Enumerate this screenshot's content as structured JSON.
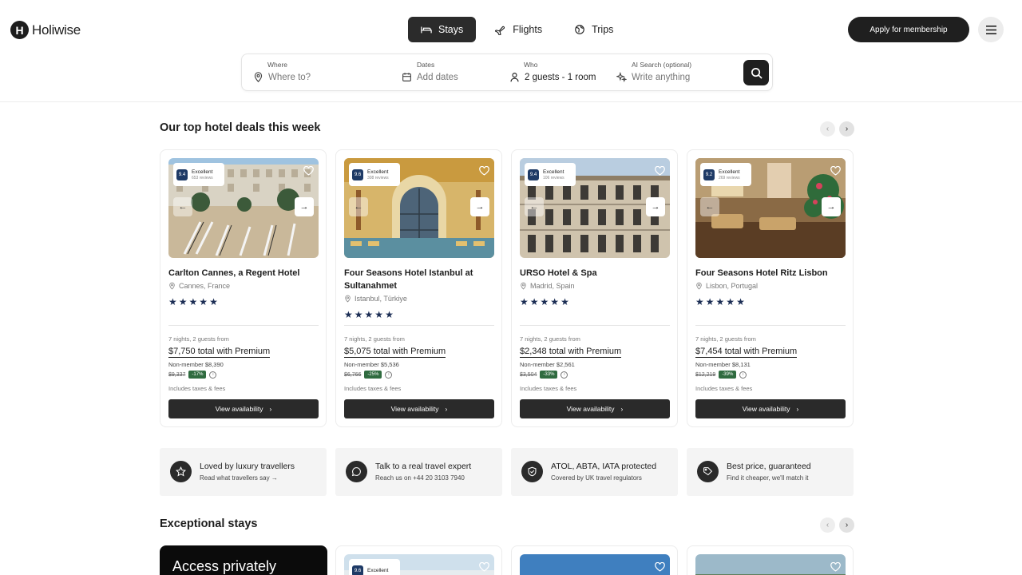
{
  "brand": {
    "name": "Holiwise",
    "mark": "H"
  },
  "nav": {
    "tabs": [
      {
        "label": "Stays",
        "icon": "bed-icon"
      },
      {
        "label": "Flights",
        "icon": "plane-icon"
      },
      {
        "label": "Trips",
        "icon": "globe-icon"
      }
    ],
    "apply_label": "Apply for membership"
  },
  "search": {
    "where_label": "Where",
    "where_placeholder": "Where to?",
    "dates_label": "Dates",
    "dates_placeholder": "Add dates",
    "who_label": "Who",
    "who_value": "2 guests - 1 room",
    "ai_label": "AI Search (optional)",
    "ai_placeholder": "Write anything"
  },
  "deals": {
    "title": "Our top hotel deals this week",
    "hotels": [
      {
        "name": "Carlton Cannes, a Regent Hotel",
        "location": "Cannes, France",
        "score": "9.4",
        "rating_label": "Excellent",
        "reviews": "653 reviews",
        "stars": 5,
        "from": "7 nights, 2 guests from",
        "premium": "$7,750 total with Premium",
        "nonmember": "Non-member $8,390",
        "strike": "$9,337",
        "discount": "-17%",
        "taxes": "Includes taxes & fees",
        "button": "View availability"
      },
      {
        "name": "Four Seasons Hotel Istanbul at Sultanahmet",
        "location": "Istanbul, Türkiye",
        "score": "9.6",
        "rating_label": "Excellent",
        "reviews": "308 reviews",
        "stars": 5,
        "from": "7 nights, 2 guests from",
        "premium": "$5,075 total with Premium",
        "nonmember": "Non-member $5,536",
        "strike": "$6,766",
        "discount": "-25%",
        "taxes": "Includes taxes & fees",
        "button": "View availability"
      },
      {
        "name": "URSO Hotel & Spa",
        "location": "Madrid, Spain",
        "score": "9.4",
        "rating_label": "Excellent",
        "reviews": "106 reviews",
        "stars": 5,
        "from": "7 nights, 2 guests from",
        "premium": "$2,348 total with Premium",
        "nonmember": "Non-member $2,561",
        "strike": "$3,504",
        "discount": "-33%",
        "taxes": "Includes taxes & fees",
        "button": "View availability"
      },
      {
        "name": "Four Seasons Hotel Ritz Lisbon",
        "location": "Lisbon, Portugal",
        "score": "9.2",
        "rating_label": "Excellent",
        "reviews": "269 reviews",
        "stars": 5,
        "from": "7 nights, 2 guests from",
        "premium": "$7,454 total with Premium",
        "nonmember": "Non-member $8,131",
        "strike": "$12,219",
        "discount": "-39%",
        "taxes": "Includes taxes & fees",
        "button": "View availability"
      }
    ]
  },
  "trust": [
    {
      "title": "Loved by luxury travellers",
      "sub": "Read what travellers say →",
      "icon": "star-icon"
    },
    {
      "title": "Talk to a real travel expert",
      "sub": "Reach us on +44 20 3103 7940",
      "icon": "chat-icon"
    },
    {
      "title": "ATOL, ABTA, IATA protected",
      "sub": "Covered by UK travel regulators",
      "icon": "shield-icon"
    },
    {
      "title": "Best price, guaranteed",
      "sub": "Find it cheaper, we'll match it",
      "icon": "tag-icon"
    }
  ],
  "exceptional": {
    "title": "Exceptional stays",
    "access_text": "Access privately",
    "mini": {
      "score": "9.6",
      "rating_label": "Excellent"
    }
  },
  "colors": {
    "accent": "#1f1f1f",
    "score_bg": "#1e3a66",
    "discount": "#2f6b3f",
    "stars": "#1b2d54"
  }
}
